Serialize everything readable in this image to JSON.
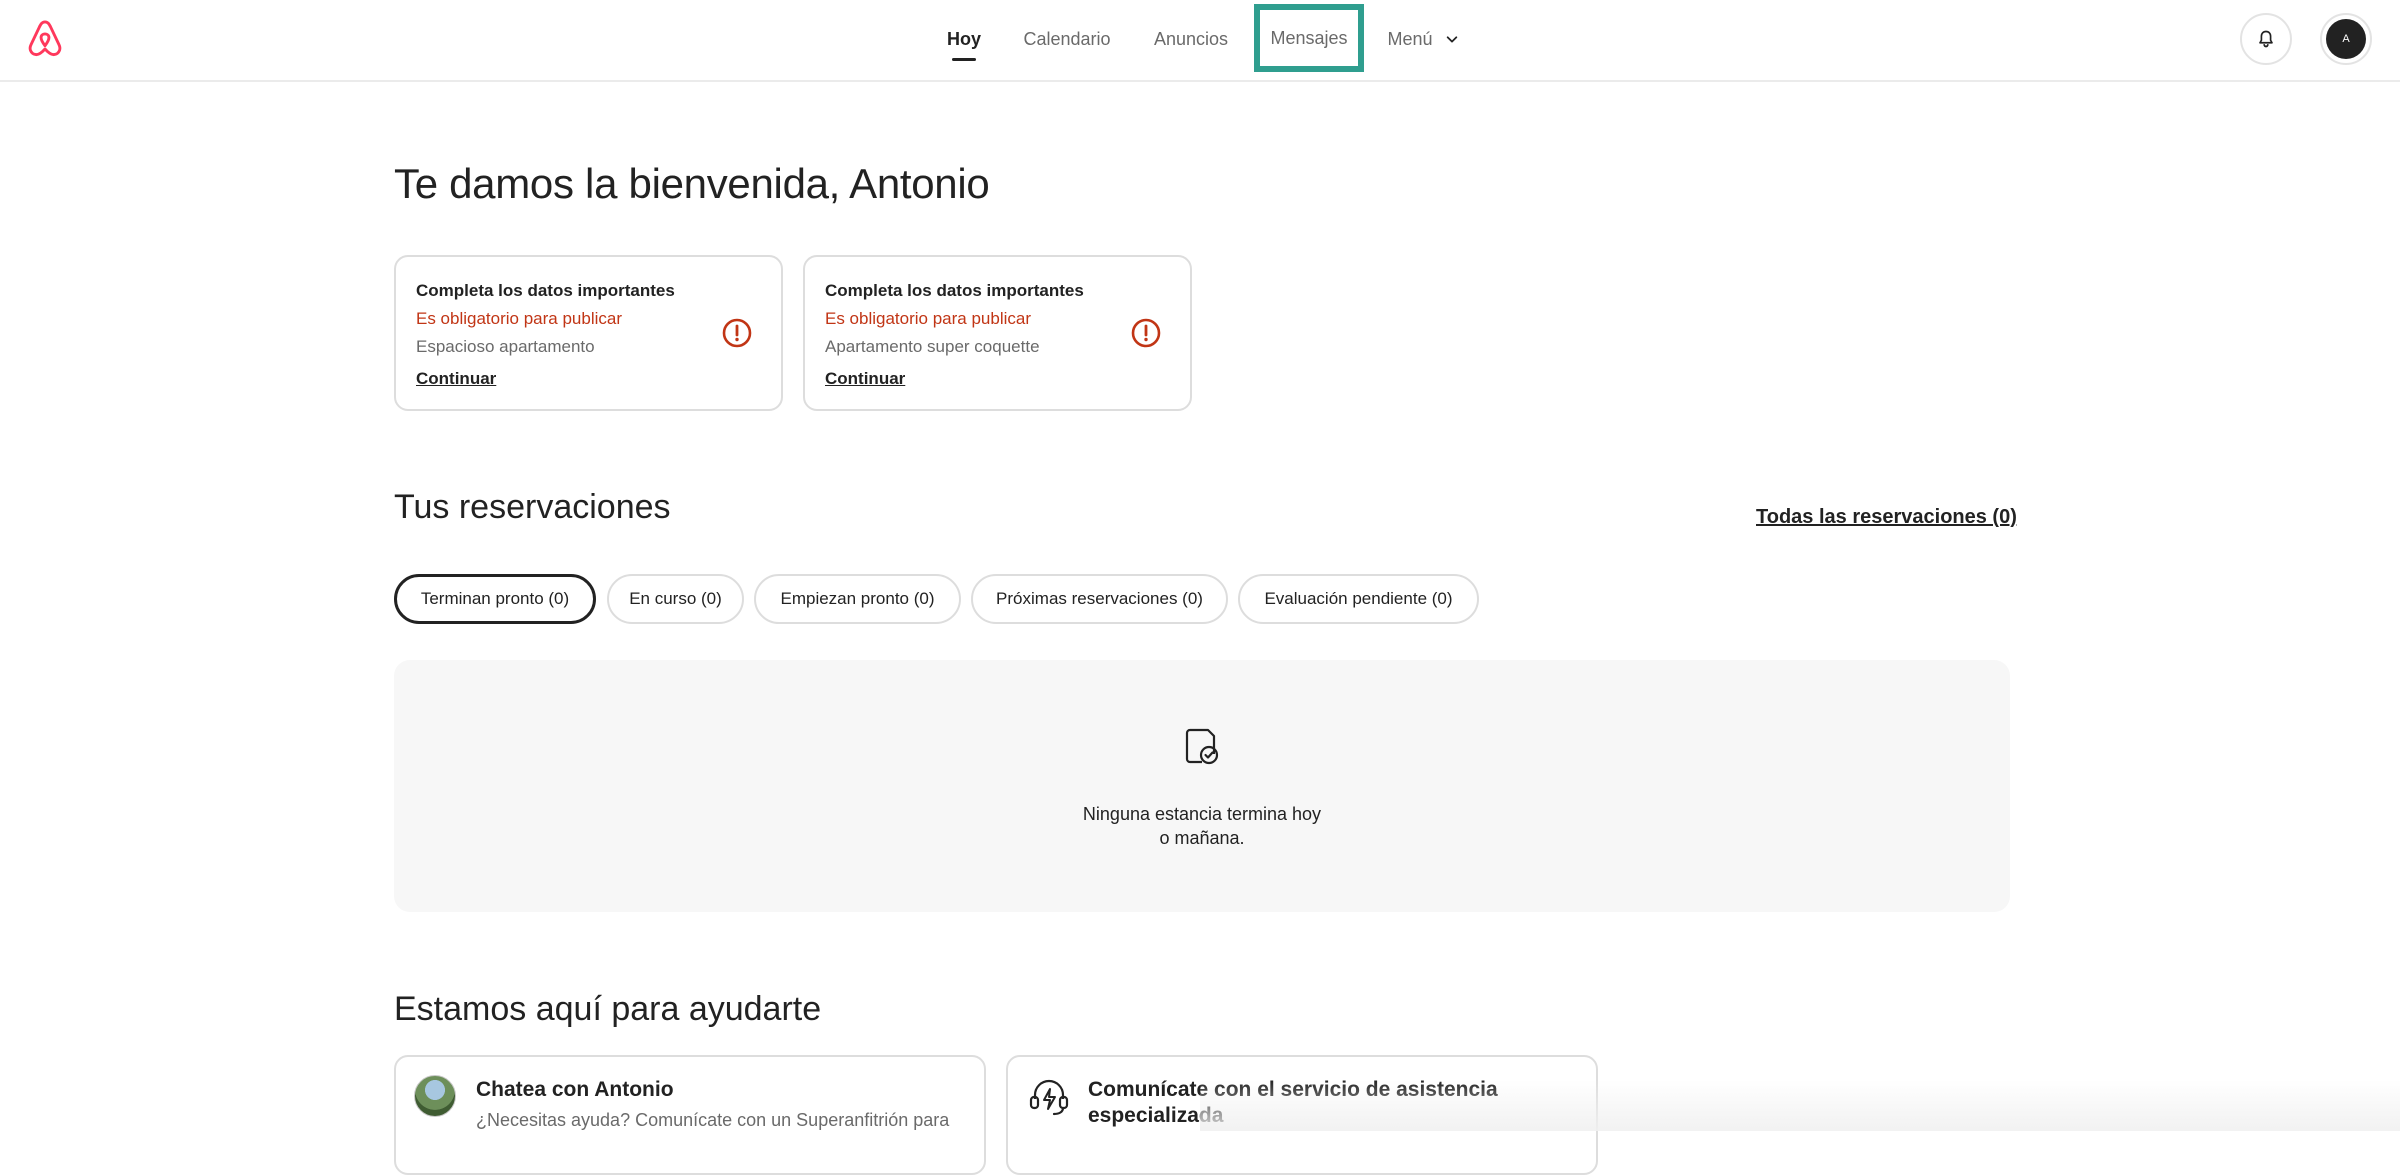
{
  "nav": {
    "items": [
      {
        "label": "Hoy"
      },
      {
        "label": "Calendario"
      },
      {
        "label": "Anuncios"
      },
      {
        "label": "Mensajes"
      },
      {
        "label": "Menú"
      }
    ],
    "active": "Hoy",
    "highlighted": "Mensajes"
  },
  "user": {
    "initial": "A"
  },
  "welcome": {
    "title": "Te damos la bienvenida, Antonio"
  },
  "tasks": [
    {
      "title": "Completa los datos importantes",
      "status": "Es obligatorio para publicar",
      "listing": "Espacioso apartamento",
      "action": "Continuar"
    },
    {
      "title": "Completa los datos importantes",
      "status": "Es obligatorio para publicar",
      "listing": "Apartamento super coquette",
      "action": "Continuar"
    }
  ],
  "reservations": {
    "title": "Tus reservaciones",
    "all_link": "Todas las reservaciones (0)",
    "filters": [
      {
        "label": "Terminan pronto (0)"
      },
      {
        "label": "En curso (0)"
      },
      {
        "label": "Empiezan pronto (0)"
      },
      {
        "label": "Próximas reservaciones (0)"
      },
      {
        "label": "Evaluación pendiente (0)"
      }
    ],
    "selected_filter": "Terminan pronto (0)",
    "empty_line1": "Ninguna estancia termina hoy",
    "empty_line2": "o mañana."
  },
  "help": {
    "title": "Estamos aquí para ayudarte",
    "cards": [
      {
        "title": "Chatea con Antonio",
        "desc": "¿Necesitas ayuda? Comunícate con un Superanfitrión para"
      },
      {
        "title_line1": "Comunícate con el servicio de asistencia",
        "title_line2": "especializada"
      }
    ]
  },
  "colors": {
    "brand": "#ff385c",
    "error": "#c13515",
    "highlight": "#2f9e8f"
  },
  "icons": [
    "airbnb-logo-icon",
    "chevron-down-icon",
    "bell-icon",
    "alert-circle-icon",
    "calendar-check-icon",
    "support-headset-icon"
  ]
}
